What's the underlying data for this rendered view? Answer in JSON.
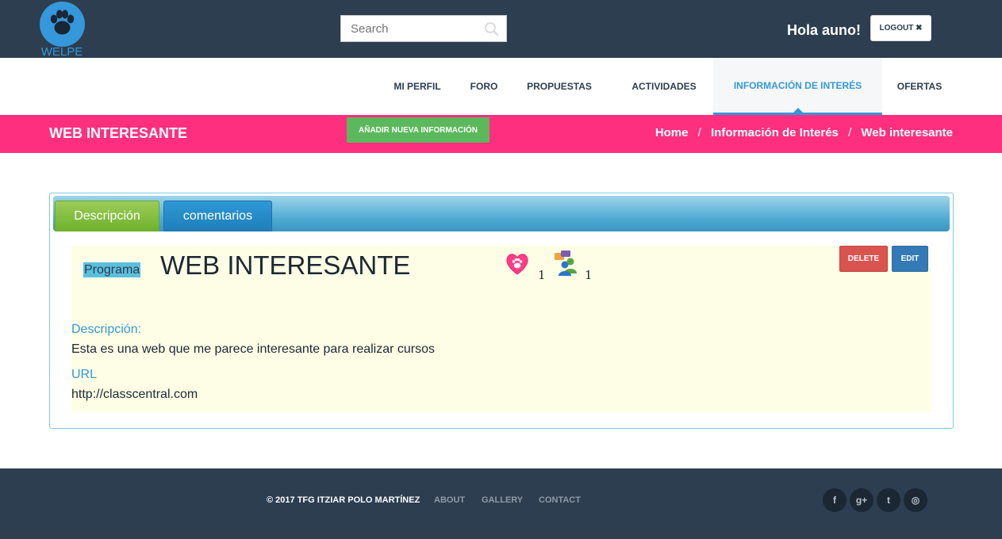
{
  "header": {
    "logo_text": "WELPE",
    "search_placeholder": "Search",
    "greeting": "Hola auno!",
    "logout_label": "LOGOUT ✖"
  },
  "nav": {
    "items": [
      {
        "label": "MI PERFIL"
      },
      {
        "label": "FORO"
      },
      {
        "label": "PROPUESTAS"
      },
      {
        "label": "ACTIVIDADES"
      },
      {
        "label": "INFORMACIÓN DE INTERÉS",
        "active": true
      },
      {
        "label": "OFERTAS"
      }
    ]
  },
  "titlebar": {
    "title": "WEB INTERESANTE",
    "add_button": "AÑADIR NUEVA INFORMACIÓN",
    "breadcrumb": [
      "Home",
      "Información de Interés",
      "Web interesante"
    ],
    "separator": "/"
  },
  "tabs": [
    {
      "label": "Descripción",
      "active": true
    },
    {
      "label": "comentarios"
    }
  ],
  "item": {
    "category": "Programa",
    "title": "WEB INTERESANTE",
    "likes": "1",
    "comments": "1",
    "delete_label": "DELETE",
    "edit_label": "EDIT",
    "description_label": "Descripción:",
    "description": "Esta es una web que me parece interesante para realizar cursos",
    "url_label": "URL",
    "url": "http://classcentral.com"
  },
  "footer": {
    "copyright": "© 2017 TFG ITZIAR POLO MARTÍNEZ",
    "links": [
      "ABOUT",
      "GALLERY",
      "CONTACT"
    ],
    "social": [
      {
        "icon": "facebook-icon",
        "glyph": "f"
      },
      {
        "icon": "google-plus-icon",
        "glyph": "g+"
      },
      {
        "icon": "twitter-icon",
        "glyph": "t"
      },
      {
        "icon": "dribbble-icon",
        "glyph": "◎"
      }
    ]
  },
  "colors": {
    "header_bg": "#2c3e50",
    "accent_pink": "#ff2f7f",
    "accent_blue": "#3498db",
    "add_green": "#5cb85c",
    "delete_red": "#d9534f",
    "edit_blue": "#337ab7",
    "content_bg": "#fefee6"
  }
}
